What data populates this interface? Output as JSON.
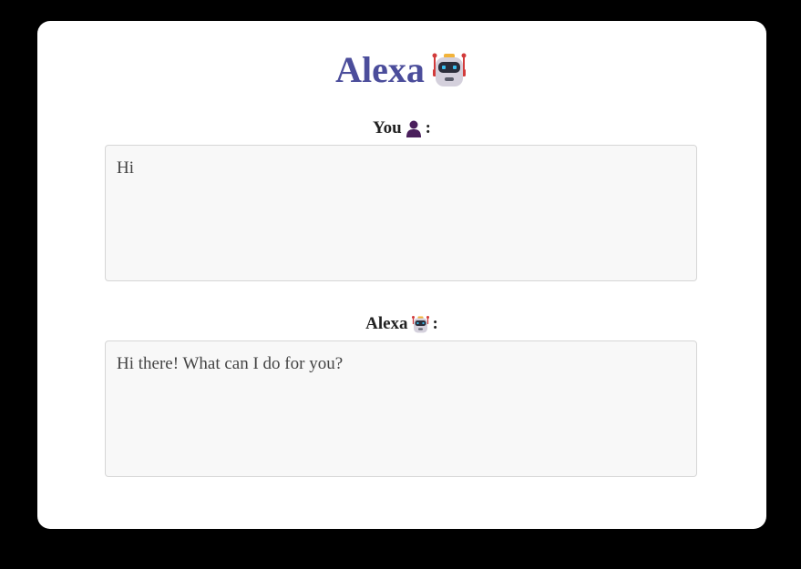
{
  "header": {
    "title": "Alexa",
    "icon": "robot-icon"
  },
  "user": {
    "label": "You",
    "icon": "person-icon",
    "suffix": ":",
    "message": "Hi"
  },
  "bot": {
    "label": "Alexa",
    "icon": "robot-icon",
    "suffix": ":",
    "message": "Hi there! What can I do for you?"
  },
  "colors": {
    "background": "#000000",
    "card": "#ffffff",
    "title": "#4b4d9b",
    "textbox_bg": "#f8f8f8",
    "textbox_border": "#d6d6d6"
  }
}
